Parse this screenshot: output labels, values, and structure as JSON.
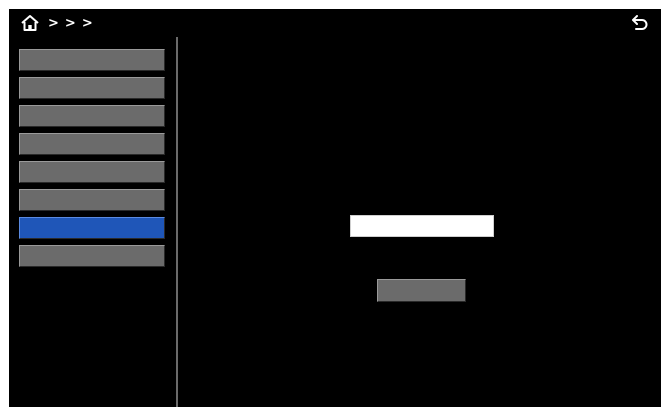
{
  "header": {
    "home_icon": "home-icon",
    "back_icon": "back-arrow-icon",
    "breadcrumb": [
      "",
      "",
      ""
    ]
  },
  "sidebar": {
    "active_index": 6,
    "items": [
      {
        "label": ""
      },
      {
        "label": ""
      },
      {
        "label": ""
      },
      {
        "label": ""
      },
      {
        "label": ""
      },
      {
        "label": ""
      },
      {
        "label": ""
      },
      {
        "label": ""
      }
    ]
  },
  "main": {
    "prompt": "",
    "input_value": "",
    "save_label": ""
  },
  "colors": {
    "background": "#000000",
    "button": "#6b6b6b",
    "active": "#1f56b8",
    "text": "#ffffff"
  }
}
